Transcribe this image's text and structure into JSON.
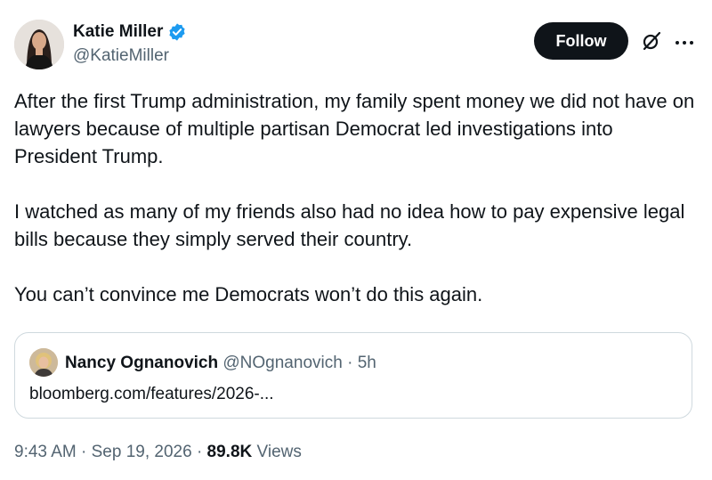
{
  "author": {
    "name": "Katie Miller",
    "handle": "@KatieMiller",
    "verified": true
  },
  "actions": {
    "follow_label": "Follow",
    "grok_icon": "grok-slash-icon",
    "more_icon": "more-horizontal-icon"
  },
  "tweet": {
    "text": "After the first Trump administration, my family spent money we did not have on lawyers because of multiple partisan Democrat led investigations into President Trump.\n\nI watched as many of my friends also had no idea how to pay expensive legal bills because they simply served their country.\n\nYou can’t convince me Democrats won’t do this again."
  },
  "quote": {
    "name": "Nancy Ognanovich",
    "handle": "@NOgnanovich",
    "separator": "·",
    "time": "5h",
    "text": "bloomberg.com/features/2026-..."
  },
  "meta": {
    "time": "9:43 AM",
    "dot1": "·",
    "date": "Sep 19, 2026",
    "dot2": "·",
    "views_count": "89.8K",
    "views_label": "Views"
  },
  "colors": {
    "text": "#0f1419",
    "secondary": "#536471",
    "verified": "#1d9bf0",
    "border": "#cfd9de",
    "button": "#0f1419"
  }
}
